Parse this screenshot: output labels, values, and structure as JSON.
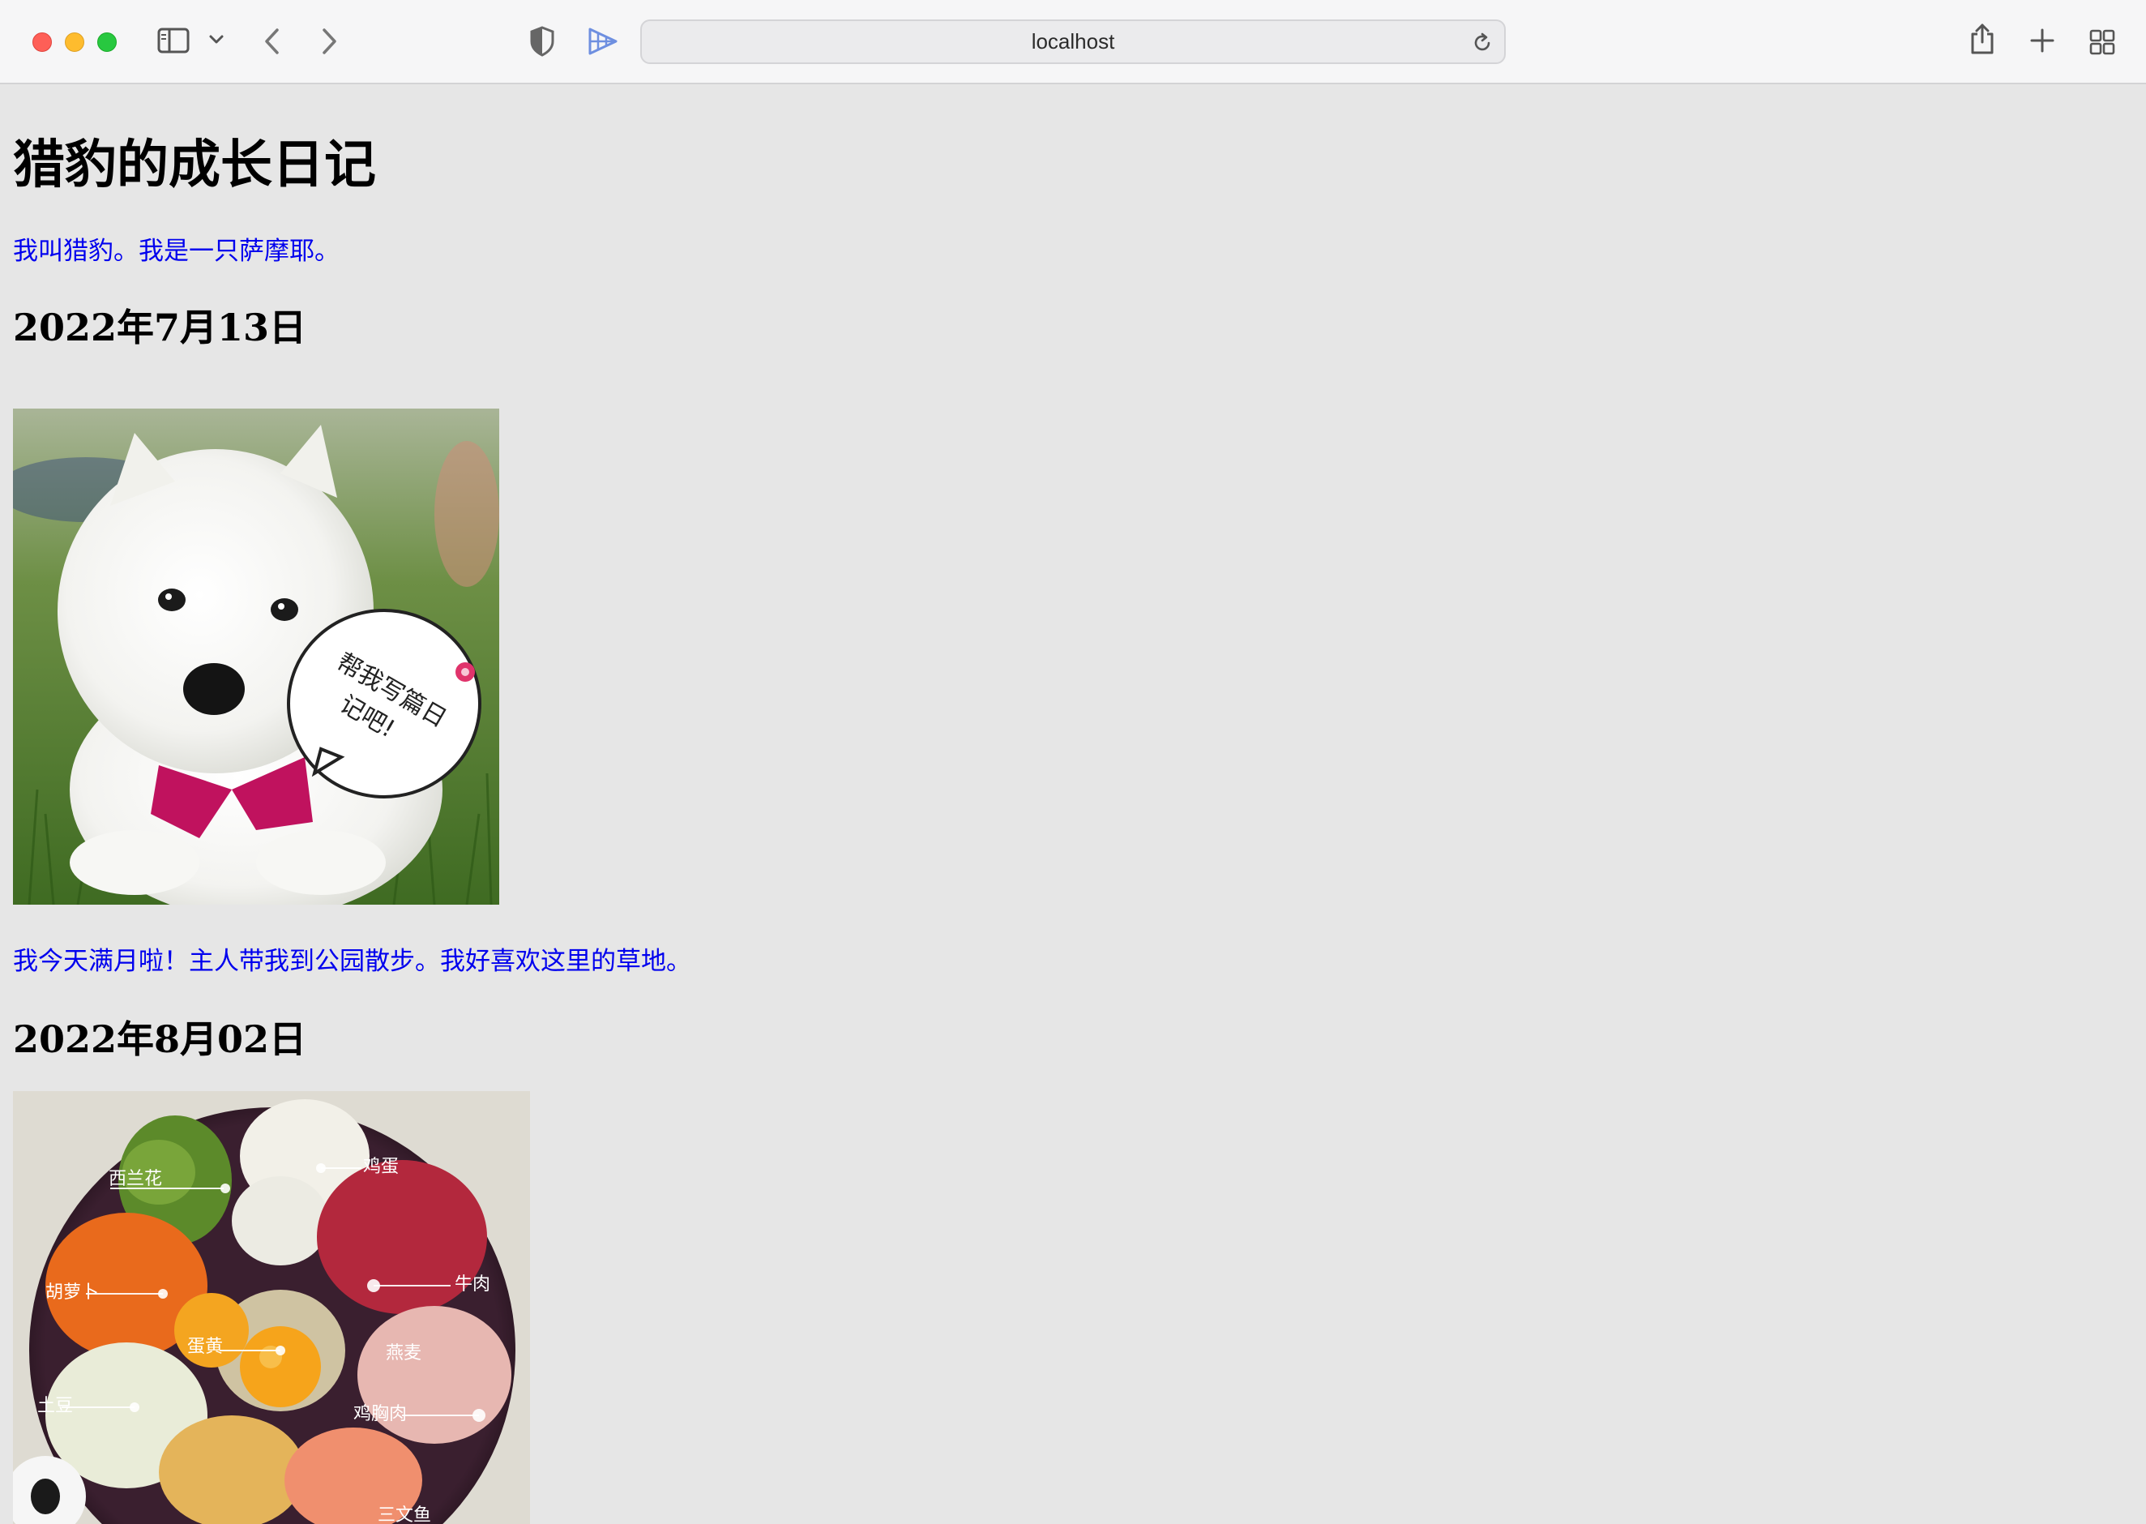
{
  "browser": {
    "url": "localhost",
    "icons": [
      "sidebar-icon",
      "chevron-down-icon",
      "back-icon",
      "forward-icon",
      "privacy-shield-icon",
      "extension-icon",
      "reload-icon",
      "share-icon",
      "new-tab-icon",
      "tab-overview-icon"
    ]
  },
  "page": {
    "title": "猎豹的成长日记",
    "intro": "我叫猎豹。我是一只萨摩耶。",
    "entries": [
      {
        "date": "2022年7月13日",
        "photo": "samoyed-puppy-photo",
        "photo_text": "帮我写篇日记吧!",
        "caption": "我今天满月啦！主人带我到公园散步。我好喜欢这里的草地。"
      },
      {
        "date": "2022年8月02日",
        "photo": "dog-food-bowl-photo",
        "photo_labels": [
          "西兰花",
          "鸡蛋",
          "牛肉",
          "胡萝卜",
          "蛋黄",
          "燕麦",
          "土豆",
          "鸡胸肉",
          "三文鱼"
        ]
      }
    ]
  },
  "colors": {
    "page_background": "#e6e6e6",
    "link_text": "#0000ee",
    "heading_text": "#000000"
  }
}
